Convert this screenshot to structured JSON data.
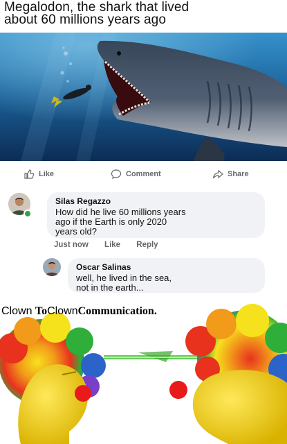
{
  "post": {
    "caption_line1": "Megalodon, the shark that lived",
    "caption_line2": "about 60 millions years ago"
  },
  "actions": {
    "like_label": "Like",
    "comment_label": "Comment",
    "share_label": "Share",
    "like_icon": "thumbs-up-icon",
    "comment_icon": "speech-bubble-icon",
    "share_icon": "share-arrow-icon"
  },
  "comments": [
    {
      "author": "Silas Regazzo",
      "text_line1": "How did he live 60 millions years",
      "text_line2": "ago if the Earth is only 2020",
      "text_line3": "years old?",
      "time": "Just now",
      "like_label": "Like",
      "reply_label": "Reply"
    },
    {
      "author": "Oscar Salinas",
      "text_line1": "well, he lived in the sea,",
      "text_line2": "not in the earth..."
    }
  ],
  "meme": {
    "word1": "Clown",
    "word2": "To",
    "word3": "Clown",
    "word4": "Communication."
  },
  "colors": {
    "ocean_top": "#2a86c4",
    "ocean_bottom": "#0d2f5a",
    "bubble_bg": "#f0f2f5",
    "meta_text": "#65676b",
    "clown_skin": "#f2d21a",
    "clown_nose": "#e81a1a",
    "beam": "#4ac43a"
  }
}
